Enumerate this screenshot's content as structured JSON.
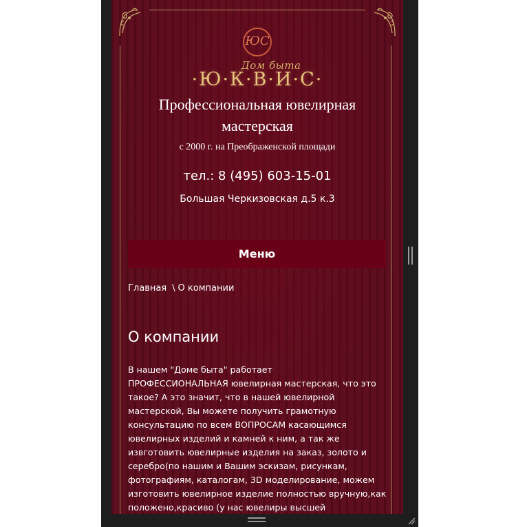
{
  "logo": {
    "monogram": "ЮС",
    "script": "Дом быта",
    "name": "·Ю·К·В·И·С·"
  },
  "header": {
    "headline": "Профессиональная ювелирная мастерская",
    "since": "с 2000 г. на Преображенской площади",
    "phone": "тел.: 8 (495) 603-15-01",
    "address": "Большая Черкизовская д.5 к.3"
  },
  "nav": {
    "menu_label": "Меню"
  },
  "breadcrumb": {
    "home": "Главная",
    "separator": "\\",
    "current": "О компании"
  },
  "content": {
    "title": "О компании",
    "paragraph": " В нашем \"Доме быта\" работает\nПРОФЕССИОНАЛЬНАЯ ювелирная мастерская, что это\nтакое?  А это значит, что в нашей ювелирной\nмастерской, Вы можете получить грамотную\nконсультацию по всем ВОПРОСАМ касающимся\nювелирных изделий и камней к ним, а так же\nизвготовить ювелирные изделия на заказ, золото и\nсеребро(по нашим и Вашим эскизам, рисункам,\nфотографиям, каталогам, 3D моделирование, можем\nизготовить ювелирное изделие полностью вручную,как\nположено,красиво (у нас ювелиры высшей"
  },
  "colors": {
    "background": "#5a0a1b",
    "menu_button": "#6a0018",
    "gold": "#c7a66a"
  }
}
